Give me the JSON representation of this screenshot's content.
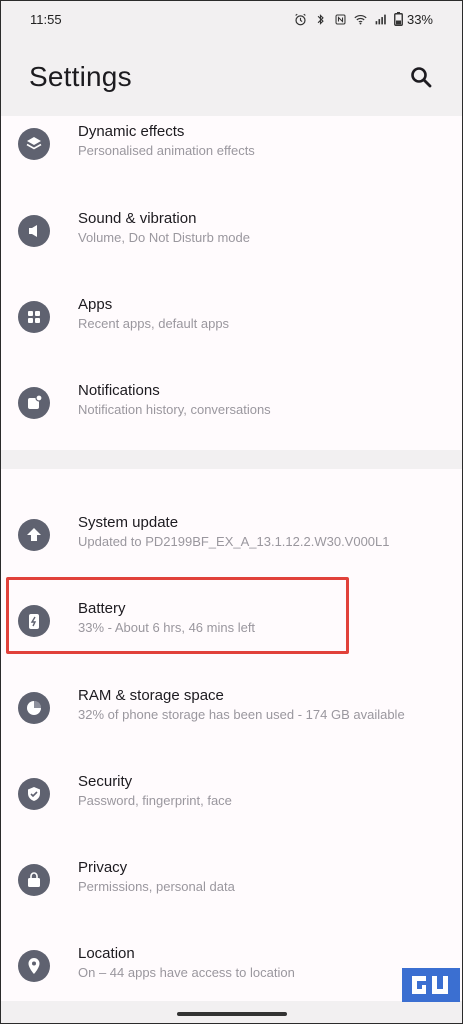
{
  "status_bar": {
    "time": "11:55",
    "battery_percent": "33%"
  },
  "header": {
    "title": "Settings"
  },
  "items": [
    {
      "title": "Dynamic effects",
      "subtitle": "Personalised animation effects",
      "icon": "layers-icon"
    },
    {
      "title": "Sound & vibration",
      "subtitle": "Volume, Do Not Disturb mode",
      "icon": "speaker-icon"
    },
    {
      "title": "Apps",
      "subtitle": "Recent apps, default apps",
      "icon": "apps-grid-icon"
    },
    {
      "title": "Notifications",
      "subtitle": "Notification history, conversations",
      "icon": "notification-icon"
    },
    {
      "title": "System update",
      "subtitle": "Updated to PD2199BF_EX_A_13.1.12.2.W30.V000L1",
      "icon": "update-arrow-icon"
    },
    {
      "title": "Battery",
      "subtitle": "33% - About 6 hrs, 46 mins left",
      "icon": "battery-icon"
    },
    {
      "title": "RAM & storage space",
      "subtitle": "32% of phone storage has been used - 174 GB available",
      "icon": "storage-pie-icon"
    },
    {
      "title": "Security",
      "subtitle": "Password, fingerprint, face",
      "icon": "shield-check-icon"
    },
    {
      "title": "Privacy",
      "subtitle": "Permissions, personal data",
      "icon": "lock-bag-icon"
    },
    {
      "title": "Location",
      "subtitle": "On – 44 apps have access to location",
      "icon": "location-pin-icon"
    }
  ],
  "colors": {
    "highlight": "#e1413a",
    "icon_bg": "#5f6270"
  }
}
